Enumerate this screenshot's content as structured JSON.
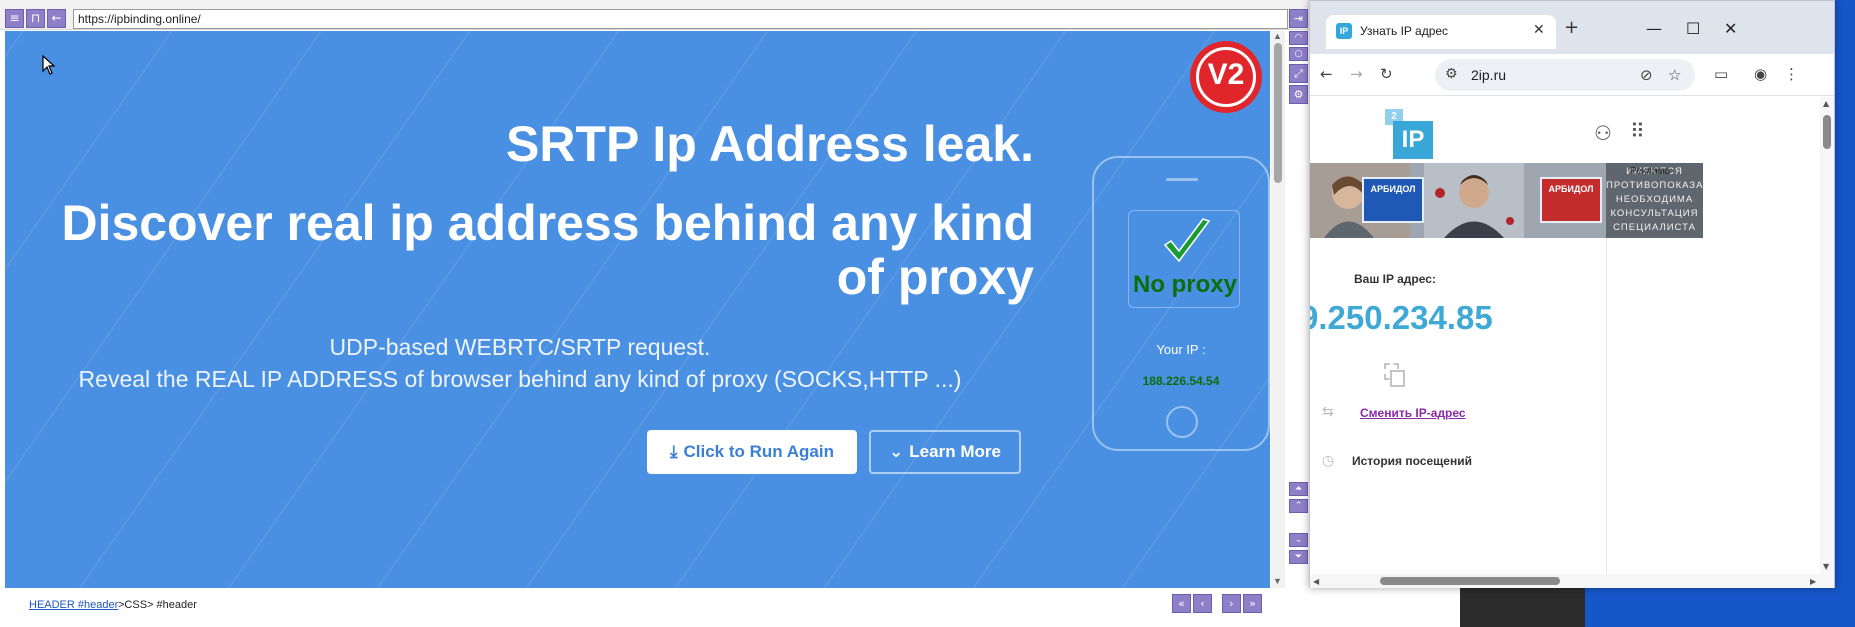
{
  "left_browser": {
    "url": "https://ipbinding.online/",
    "logo_text": "V2",
    "hero": {
      "title": "SRTP Ip Address leak.",
      "headline": "Discover real ip address behind any kind of proxy",
      "subtitle1": "UDP-based WEBRTC/SRTP request.",
      "subtitle2": "Reveal the REAL IP ADDRESS of browser behind any kind of proxy (SOCKS,HTTP ...)",
      "run_button": "Click to Run Again",
      "more_button": "Learn More"
    },
    "phone": {
      "status": "No proxy",
      "your_ip_label": "Your IP :",
      "your_ip_value": "188.226.54.54"
    },
    "status_bar": {
      "link": "HEADER #header",
      "path": ">CSS> #header"
    },
    "colors": {
      "hero_bg": "#4a90e2",
      "tool_button": "#8e7fc9",
      "status_green": "#0b6d0b"
    }
  },
  "chrome_window": {
    "tab_title": "Узнать IP адрес",
    "tab_favicon": "IP",
    "address": "2ip.ru",
    "page": {
      "logo_text": "IP",
      "logo_sup": "2",
      "ad_label": "Реклама",
      "ad_brand": "АРБИДОЛ",
      "ad_warning": "ИМЕЮТСЯ ПРОТИВОПОКАЗАНИЯ. НЕОБХОДИМА КОНСУЛЬТАЦИЯ СПЕЦИАЛИСТА",
      "ip_label": "Ваш IP адрес:",
      "ip_value": "9.250.234.85",
      "change_ip_link": "Сменить IP-адрес",
      "history_label": "История посещений"
    },
    "colors": {
      "ip_value": "#3fa9d5",
      "link": "#8a2aa6"
    }
  }
}
